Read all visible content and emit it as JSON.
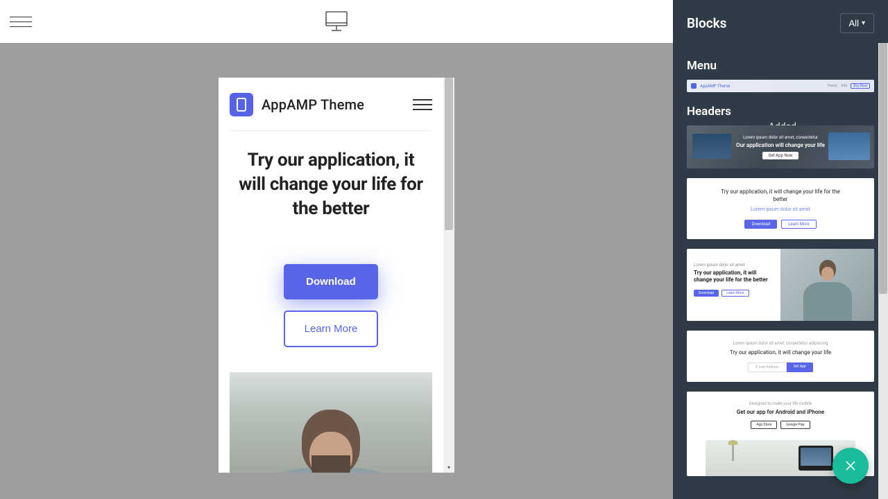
{
  "sidebar": {
    "title": "Blocks",
    "filter_label": "All",
    "added_label": "Added",
    "sections": {
      "menu": "Menu",
      "headers": "Headers"
    },
    "thumb_menu": {
      "brand": "AppAMP Theme",
      "nav1": "Home",
      "nav2": "Info",
      "btn": "Buy Now"
    },
    "thumb_h1": {
      "sub": "Lorem ipsum dolor sit amet, consectetur",
      "title": "Our application will change your life",
      "btn": "Get App Now"
    },
    "thumb_h2": {
      "title": "Try our application, it will change your life for the better",
      "sub": "Lorem ipsum dolor sit amet",
      "btn1": "Download",
      "btn2": "Learn More"
    },
    "thumb_h3": {
      "sub": "Lorem ipsum dolor sit amet",
      "title": "Try our application, it will change your life for the better",
      "btn1": "Download",
      "btn2": "Learn More"
    },
    "thumb_h4": {
      "sub": "Lorem ipsum dolor sit amet, consectetur adipiscing",
      "title": "Try our application, it will change your life",
      "placeholder": "E-mail Address",
      "btn": "Get App"
    },
    "thumb_h5": {
      "sub": "Designed to make your life mobile",
      "title": "Get our app for Android and iPhone",
      "btn1": "App Store",
      "btn2": "Google Play"
    }
  },
  "preview": {
    "brand": "AppAMP Theme",
    "title": "Try our application, it will change your life for the better",
    "btn_primary": "Download",
    "btn_secondary": "Learn More"
  }
}
